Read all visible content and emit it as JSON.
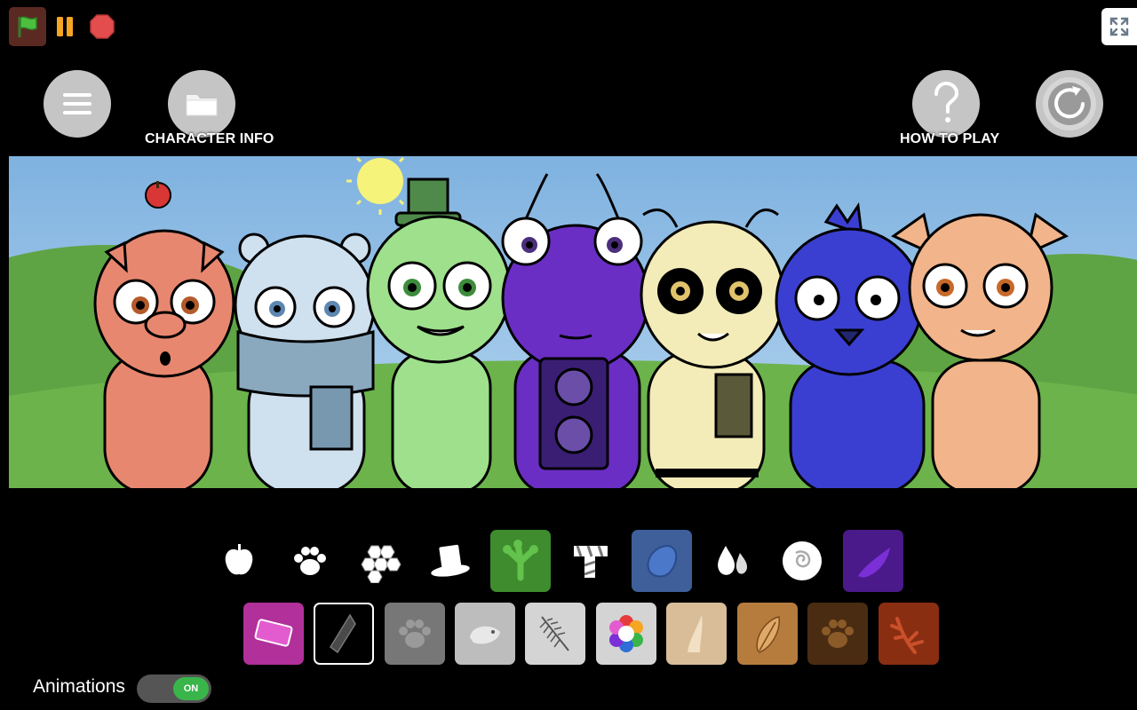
{
  "top_controls": {
    "green_flag_icon": "green-flag-icon",
    "pause_icon": "pause-icon",
    "stop_icon": "stop-icon",
    "fullscreen_icon": "fullscreen-icon"
  },
  "buttons": {
    "menu": {
      "icon": "hamburger-menu-icon"
    },
    "character_info": {
      "icon": "folder-icon",
      "label": "CHARACTER INFO"
    },
    "how_to_play": {
      "icon": "question-mark-icon",
      "label": "HOW TO PLAY"
    },
    "reset": {
      "icon": "refresh-icon"
    }
  },
  "characters": [
    {
      "name": "pig",
      "color": "#e8876f",
      "accessory": "apple"
    },
    {
      "name": "polar-bear",
      "color": "#cfe0ee",
      "accessory": "scarf"
    },
    {
      "name": "frog",
      "color": "#9ee08c",
      "accessory": "top-hat"
    },
    {
      "name": "purple-bug",
      "color": "#6a2ec4",
      "accessory": "speaker"
    },
    {
      "name": "bee",
      "color": "#f3ecb8",
      "accessory": "scarf"
    },
    {
      "name": "blue-bird",
      "color": "#3a3fd1",
      "accessory": "crest"
    },
    {
      "name": "cat",
      "color": "#f2b48a",
      "accessory": "none"
    }
  ],
  "palette_row1": [
    {
      "icon": "apple-icon",
      "bg": "#000000",
      "fg": "#ffffff"
    },
    {
      "icon": "paw-icon",
      "bg": "#000000",
      "fg": "#ffffff"
    },
    {
      "icon": "honeycomb-icon",
      "bg": "#000000",
      "fg": "#ffffff"
    },
    {
      "icon": "top-hat-icon",
      "bg": "#000000",
      "fg": "#ffffff"
    },
    {
      "icon": "frog-foot-icon",
      "bg": "#3e8c2e",
      "fg": "#62c24c"
    },
    {
      "icon": "striped-scarf-icon",
      "bg": "#000000",
      "fg": "#ffffff"
    },
    {
      "icon": "blue-stone-icon",
      "bg": "#3e5f9a",
      "fg": "#4b78c9"
    },
    {
      "icon": "water-drops-icon",
      "bg": "#000000",
      "fg": "#ffffff"
    },
    {
      "icon": "swirl-icon",
      "bg": "#000000",
      "fg": "#ffffff"
    },
    {
      "icon": "purple-feather-icon",
      "bg": "#4a1a8a",
      "fg": "#7b2fd6"
    }
  ],
  "palette_row2": [
    {
      "icon": "pink-eraser-icon",
      "bg": "#b1309a",
      "fg": "#e35ccf"
    },
    {
      "icon": "crystal-icon",
      "bg": "#000000",
      "fg": "#666666",
      "selected": true
    },
    {
      "icon": "gray-paw-icon",
      "bg": "#777777",
      "fg": "#9a9a9a"
    },
    {
      "icon": "fish-icon",
      "bg": "#bdbdbd",
      "fg": "#e8e8e8"
    },
    {
      "icon": "fern-icon",
      "bg": "#d4d4d4",
      "fg": "#555555"
    },
    {
      "icon": "rainbow-flower-icon",
      "bg": "#d4d4d4",
      "fg": "#ffffff"
    },
    {
      "icon": "horn-icon",
      "bg": "#d8bd98",
      "fg": "#f2e0c4"
    },
    {
      "icon": "brown-feather-icon",
      "bg": "#b57c3e",
      "fg": "#e0a968"
    },
    {
      "icon": "brown-paw-icon",
      "bg": "#4a2c12",
      "fg": "#8a5a28"
    },
    {
      "icon": "antler-icon",
      "bg": "#8a2e12",
      "fg": "#c9502a"
    }
  ],
  "animations": {
    "label": "Animations",
    "toggle": "ON"
  }
}
